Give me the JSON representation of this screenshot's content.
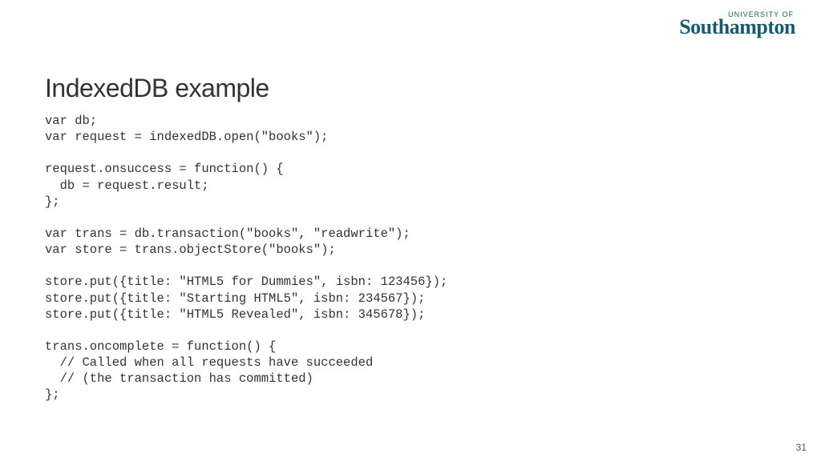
{
  "logo": {
    "top": "UNIVERSITY OF",
    "main": "Southampton"
  },
  "title": "IndexedDB example",
  "code": "var db;\nvar request = indexedDB.open(\"books\");\n\nrequest.onsuccess = function() {\n  db = request.result;\n};\n\nvar trans = db.transaction(\"books\", \"readwrite\");\nvar store = trans.objectStore(\"books\");\n\nstore.put({title: \"HTML5 for Dummies\", isbn: 123456});\nstore.put({title: \"Starting HTML5\", isbn: 234567});\nstore.put({title: \"HTML5 Revealed\", isbn: 345678});\n\ntrans.oncomplete = function() {\n  // Called when all requests have succeeded\n  // (the transaction has committed)\n};",
  "pageNumber": "31"
}
